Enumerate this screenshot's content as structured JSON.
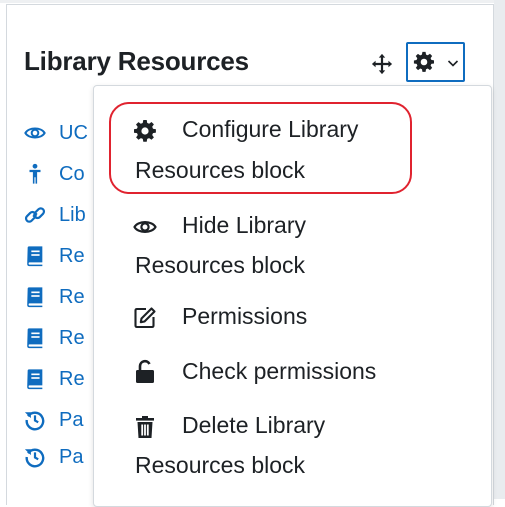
{
  "block": {
    "title": "Library Resources",
    "items": [
      {
        "icon": "eye-icon",
        "text": "UC"
      },
      {
        "icon": "person-icon",
        "text": "Co"
      },
      {
        "icon": "link-icon",
        "text": "Lib"
      },
      {
        "icon": "book-icon",
        "text": "Re"
      },
      {
        "icon": "book-icon",
        "text": "Re"
      },
      {
        "icon": "book-icon",
        "text": "Re"
      },
      {
        "icon": "book-icon",
        "text": "Re"
      },
      {
        "icon": "history-icon",
        "text": "Pa"
      },
      {
        "icon": "history-icon",
        "text": "Pa"
      }
    ]
  },
  "menu": {
    "configure": {
      "line1": "Configure Library",
      "line2": "Resources block",
      "icon": "gear-icon"
    },
    "hide": {
      "line1": "Hide Library",
      "line2": "Resources block",
      "icon": "eye-icon"
    },
    "permissions": {
      "line1": "Permissions",
      "icon": "edit-icon"
    },
    "check": {
      "line1": "Check permissions",
      "icon": "unlock-icon"
    },
    "delete": {
      "line1": "Delete Library",
      "line2": "Resources block",
      "icon": "trash-icon"
    }
  },
  "colors": {
    "link": "#0f6cbf",
    "text": "#1d2125",
    "highlight": "#e0232f"
  }
}
